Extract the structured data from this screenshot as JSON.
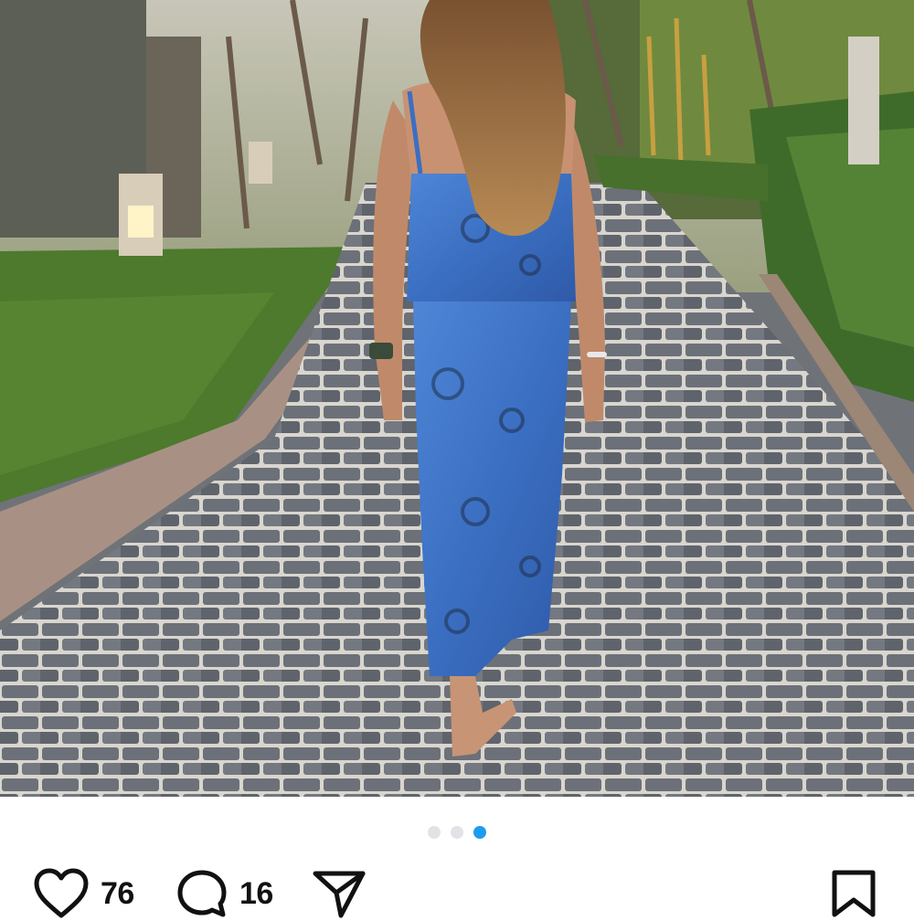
{
  "post": {
    "image_description_name": "post-photo",
    "carousel": {
      "total": 3,
      "active_index": 2
    },
    "likes_count": "76",
    "comments_count": "16"
  },
  "icons": {
    "like": "heart-icon",
    "comment": "comment-bubble-icon",
    "share": "paper-plane-icon",
    "save": "bookmark-icon"
  },
  "colors": {
    "active_dot": "#1d9bf0",
    "inactive_dot": "#e2e3e6",
    "icon": "#111111"
  }
}
